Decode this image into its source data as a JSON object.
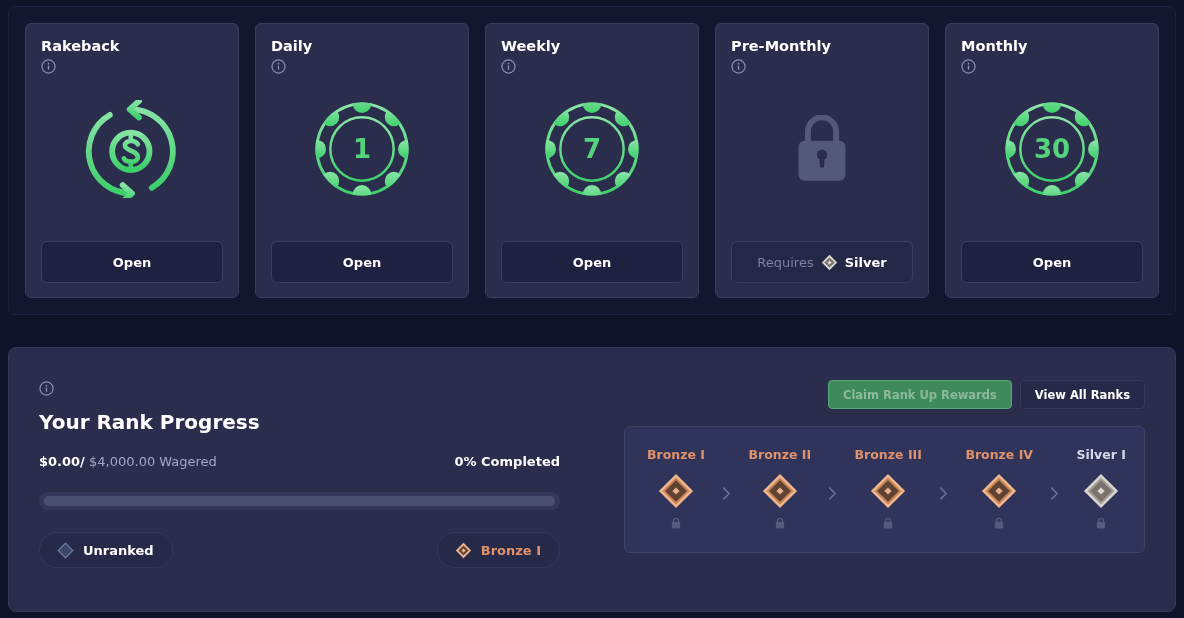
{
  "reward_cards": [
    {
      "kind": "rakeback",
      "title": "Rakeback",
      "button": {
        "label": "Open"
      }
    },
    {
      "kind": "chip",
      "title": "Daily",
      "chip_label": "1",
      "button": {
        "label": "Open"
      }
    },
    {
      "kind": "chip",
      "title": "Weekly",
      "chip_label": "7",
      "button": {
        "label": "Open"
      }
    },
    {
      "kind": "locked",
      "title": "Pre-Monthly",
      "requirement": {
        "label": "Requires",
        "rank": "Silver",
        "kind": "silver"
      }
    },
    {
      "kind": "chip",
      "title": "Monthly",
      "chip_label": "30",
      "button": {
        "label": "Open"
      }
    }
  ],
  "rank_progress": {
    "title": "Your Rank Progress",
    "wagered": "$0.00/",
    "target": "$4,000.00",
    "wagered_label": "Wagered",
    "completed": "0% Completed",
    "level": 0,
    "current_rank": {
      "label": "Unranked",
      "kind": "unranked"
    },
    "next_rank": {
      "label": "Bronze I",
      "kind": "bronze"
    },
    "buttons": [
      {
        "kind": "claim",
        "label": "Claim Rank Up Rewards",
        "disabled": true
      },
      {
        "kind": "view",
        "label": "View All Ranks",
        "disabled": false
      }
    ],
    "ranks": [
      {
        "name": "Bronze I",
        "kind": "bronze",
        "locked": true
      },
      {
        "name": "Bronze II",
        "kind": "bronze",
        "locked": true
      },
      {
        "name": "Bronze III",
        "kind": "bronze",
        "locked": true
      },
      {
        "name": "Bronze IV",
        "kind": "bronze",
        "locked": true
      },
      {
        "name": "Silver I",
        "kind": "silver",
        "locked": true
      }
    ]
  }
}
